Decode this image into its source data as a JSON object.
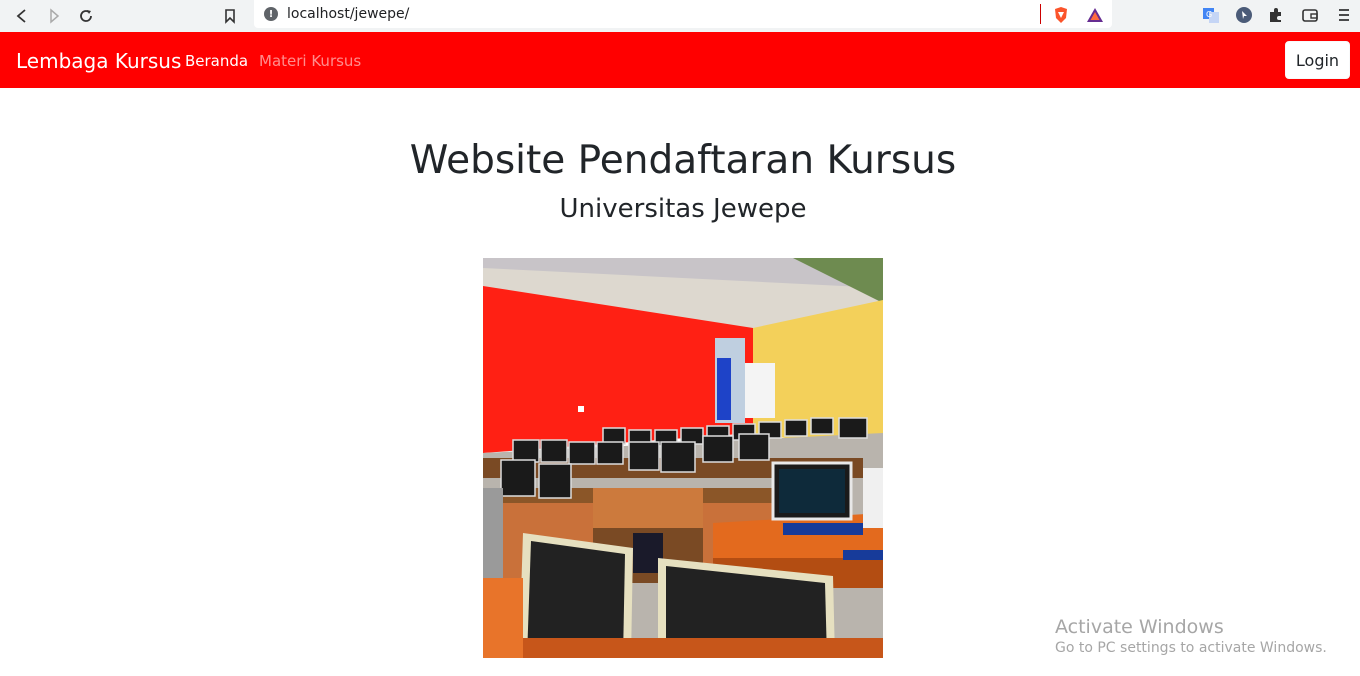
{
  "browser": {
    "url": "localhost/jewepe/",
    "back_icon": "back-arrow-icon",
    "forward_icon": "forward-arrow-icon",
    "reload_icon": "reload-icon",
    "bookmark_icon": "bookmark-icon",
    "site_info_icon": "info-icon",
    "extensions": [
      "brave-shield-icon",
      "brave-rewards-icon",
      "translate-icon",
      "cursor-extension-icon",
      "puzzle-icon",
      "wallet-icon",
      "menu-icon"
    ]
  },
  "navbar": {
    "brand": "Lembaga Kursus",
    "links": [
      "Beranda",
      "Materi Kursus"
    ],
    "login": "Login",
    "color": "#ff0000"
  },
  "main": {
    "title": "Website Pendaftaran Kursus",
    "subtitle": "Universitas Jewepe",
    "image_alt": "computer lab classroom photo"
  },
  "watermark": {
    "line1": "Activate Windows",
    "line2": "Go to PC settings to activate Windows."
  }
}
